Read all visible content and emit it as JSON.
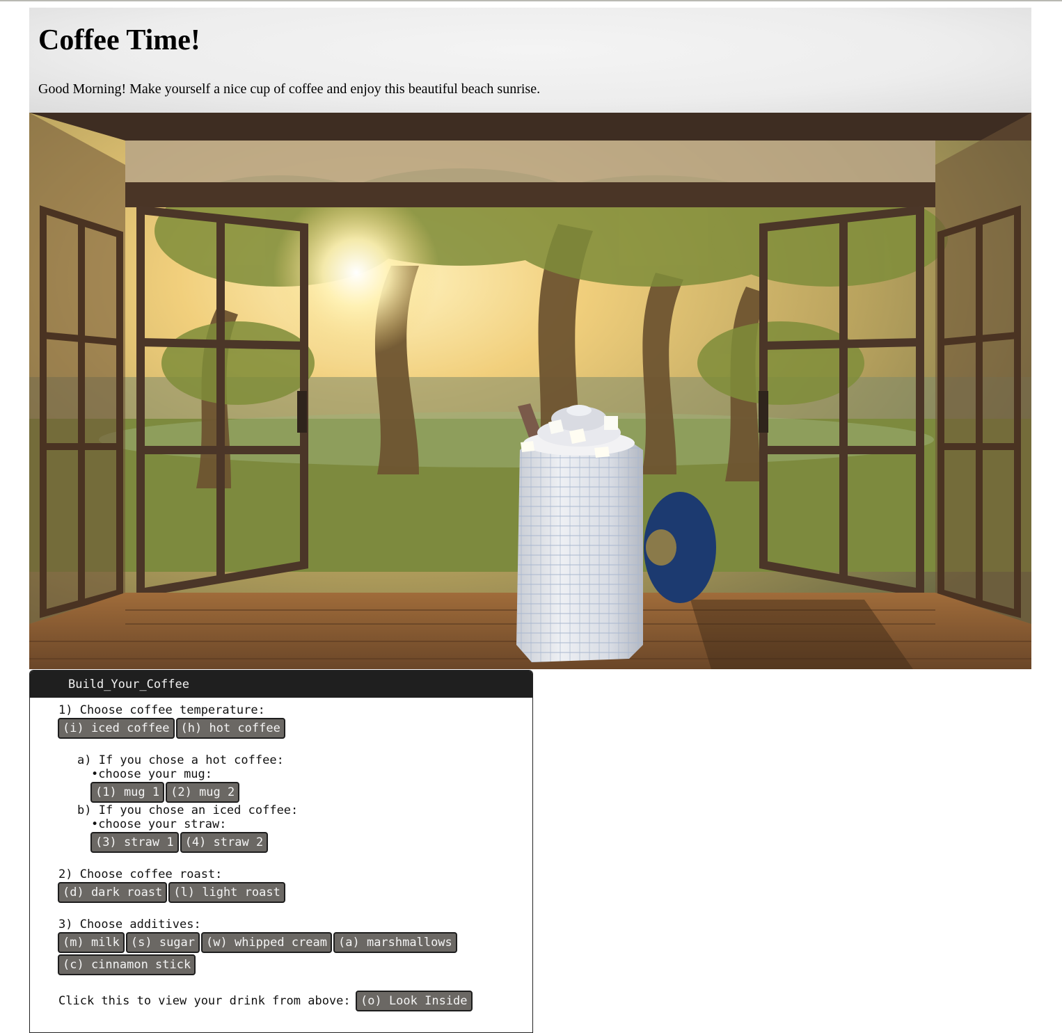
{
  "header": {
    "title": "Coffee Time!",
    "subtitle": "Good Morning! Make yourself a nice cup of coffee and enjoy this beautiful beach sunrise."
  },
  "scene": {
    "colors": {
      "sky": "#f3d58a",
      "sun": "#fff6c8",
      "wood": "#6b4a2e",
      "floor": "#8a5a31",
      "cup": "#dfe3ea",
      "mug_handle": "#1e3f7a"
    }
  },
  "panel": {
    "title": "Build_Your_Coffee",
    "step1": "1) Choose coffee temperature:",
    "temperature": [
      "(i) iced coffee",
      "(h) hot coffee"
    ],
    "hot_heading": "a) If you chose a hot coffee:",
    "hot_sub": "choose your mug:",
    "mugs": [
      "(1) mug 1",
      "(2) mug 2"
    ],
    "iced_heading": "b) If you chose an iced coffee:",
    "iced_sub": "choose your straw:",
    "straws": [
      "(3) straw 1",
      "(4) straw 2"
    ],
    "step2": "2) Choose coffee roast:",
    "roasts": [
      "(d) dark roast",
      "(l) light roast"
    ],
    "step3": "3) Choose additives:",
    "additives_row1": [
      "(m) milk",
      "(s) sugar",
      "(w) whipped cream",
      "(a) marshmallows"
    ],
    "additives_row2": [
      "(c) cinnamon stick"
    ],
    "look_label": "Click this to view your drink from above:",
    "look_button": "(o) Look Inside"
  }
}
